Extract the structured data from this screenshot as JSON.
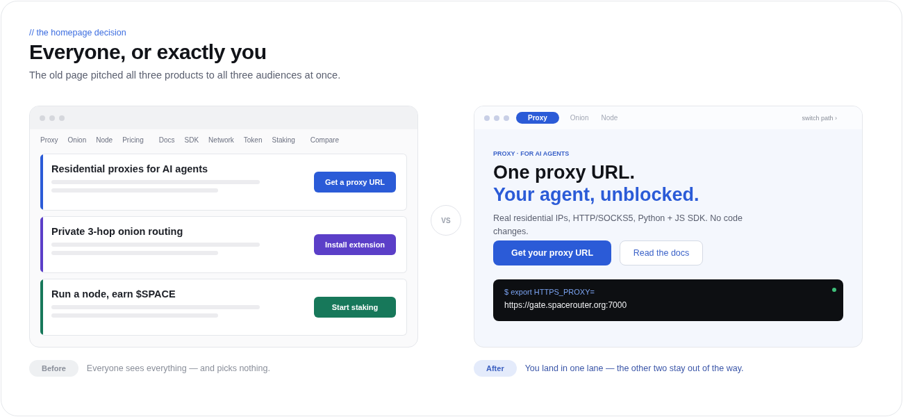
{
  "eyebrow": "// the homepage decision",
  "title": "Everyone, or exactly you",
  "subtitle": "The old page pitched all three products to all three audiences at once.",
  "before": {
    "nav": [
      "Proxy",
      "Onion",
      "Node",
      "Pricing",
      "Docs",
      "SDK",
      "Network",
      "Token",
      "Staking",
      "Compare"
    ],
    "cards": [
      {
        "title": "Residential proxies for AI agents",
        "button": "Get a proxy URL",
        "color": "#2b5bd7"
      },
      {
        "title": "Private 3-hop onion routing",
        "button": "Install extension",
        "color": "#5b3fc8"
      },
      {
        "title": "Run a node, earn $SPACE",
        "button": "Start staking",
        "color": "#17785a"
      }
    ],
    "badge": "Before",
    "caption": "Everyone sees everything — and picks nothing."
  },
  "vs": "VS",
  "after": {
    "tabs": [
      {
        "label": "Proxy",
        "selected": true
      },
      {
        "label": "Onion",
        "selected": false
      },
      {
        "label": "Node",
        "selected": false
      }
    ],
    "switch": "switch path ›",
    "eyebrow": "PROXY · FOR AI AGENTS",
    "headline": "One proxy URL.",
    "headline_accent": "Your agent, unblocked.",
    "body": "Real residential IPs, HTTP/SOCKS5, Python + JS SDK. No code changes.",
    "primary": "Get your proxy URL",
    "secondary": "Read the docs",
    "terminal": {
      "command": "$ export HTTPS_PROXY=",
      "value": "https://gate.spacerouter.org:7000"
    },
    "badge": "After",
    "caption": "You land in one lane — the other two stay out of the way."
  }
}
